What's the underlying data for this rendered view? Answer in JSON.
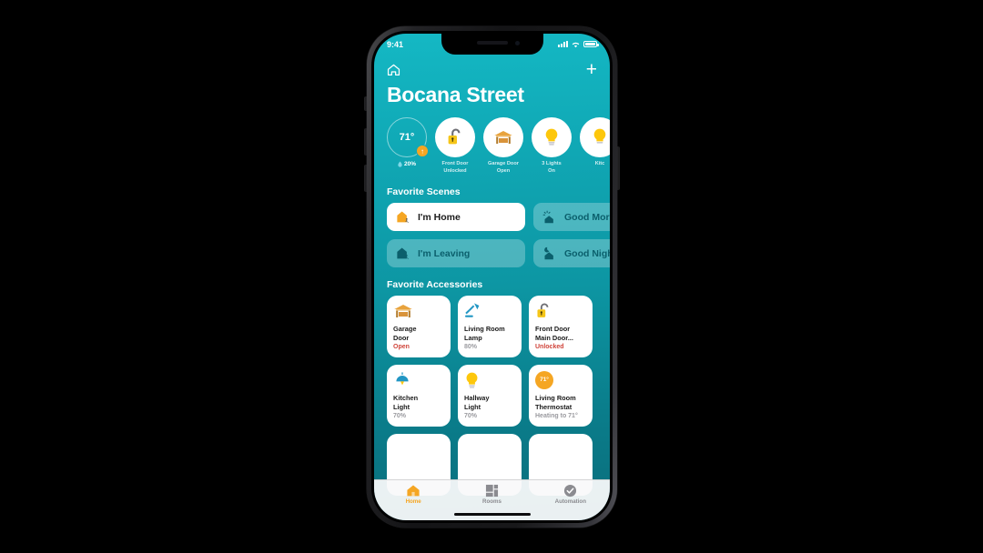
{
  "status_bar": {
    "time": "9:41",
    "signal_icon": "cellular-bars-icon",
    "wifi_icon": "wifi-icon",
    "battery_icon": "battery-icon"
  },
  "nav": {
    "home_icon": "house-outline-icon",
    "add_label": "+"
  },
  "header": {
    "title": "Bocana Street"
  },
  "status_bubbles": [
    {
      "name": "temperature",
      "value": "71°",
      "badge": "↑",
      "sub_icon": "water-drop-icon",
      "sub_value": "20%",
      "label": ""
    },
    {
      "name": "front-door",
      "icon": "unlocked-padlock-icon",
      "label": "Front Door\nUnlocked"
    },
    {
      "name": "garage-door",
      "icon": "garage-icon",
      "label": "Garage Door\nOpen"
    },
    {
      "name": "lights",
      "icon": "lightbulb-icon",
      "label": "3 Lights\nOn"
    },
    {
      "name": "kitchen",
      "icon": "lightbulb-icon",
      "label": "Kitc"
    }
  ],
  "scenes_section": {
    "title": "Favorite Scenes"
  },
  "scenes": [
    {
      "label": "I'm Home",
      "icon": "house-orange-icon",
      "active": true
    },
    {
      "label": "Good Morning",
      "icon": "sun-house-icon",
      "active": false
    },
    {
      "label": "I'm Leaving",
      "icon": "house-walking-icon",
      "active": false
    },
    {
      "label": "Good Night",
      "icon": "moon-house-icon",
      "active": false
    }
  ],
  "accessories_section": {
    "title": "Favorite Accessories"
  },
  "accessories": [
    {
      "icon": "garage-icon",
      "name": "Garage\nDoor",
      "status": "Open",
      "alert": true
    },
    {
      "icon": "desk-lamp-icon",
      "name": "Living Room\nLamp",
      "status": "80%",
      "alert": false
    },
    {
      "icon": "unlocked-padlock-icon",
      "name": "Front Door\nMain Door...",
      "status": "Unlocked",
      "alert": true
    },
    {
      "icon": "pendant-light-icon",
      "name": "Kitchen\nLight",
      "status": "70%",
      "alert": false
    },
    {
      "icon": "lightbulb-icon",
      "name": "Hallway\nLight",
      "status": "70%",
      "alert": false
    },
    {
      "icon": "thermostat-icon",
      "icon_value": "71°",
      "name": "Living Room\nThermostat",
      "status": "Heating to 71°",
      "alert": false
    }
  ],
  "tabs": [
    {
      "label": "Home",
      "icon": "house-filled-icon",
      "active": true
    },
    {
      "label": "Rooms",
      "icon": "rooms-grid-icon",
      "active": false
    },
    {
      "label": "Automation",
      "icon": "check-circle-icon",
      "active": false
    }
  ],
  "colors": {
    "accent": "#f5a623",
    "screen_top": "#14b8c4",
    "screen_bottom": "#0a6d7b",
    "alert": "#d0453b",
    "scene_text": "#0b5f6c"
  }
}
